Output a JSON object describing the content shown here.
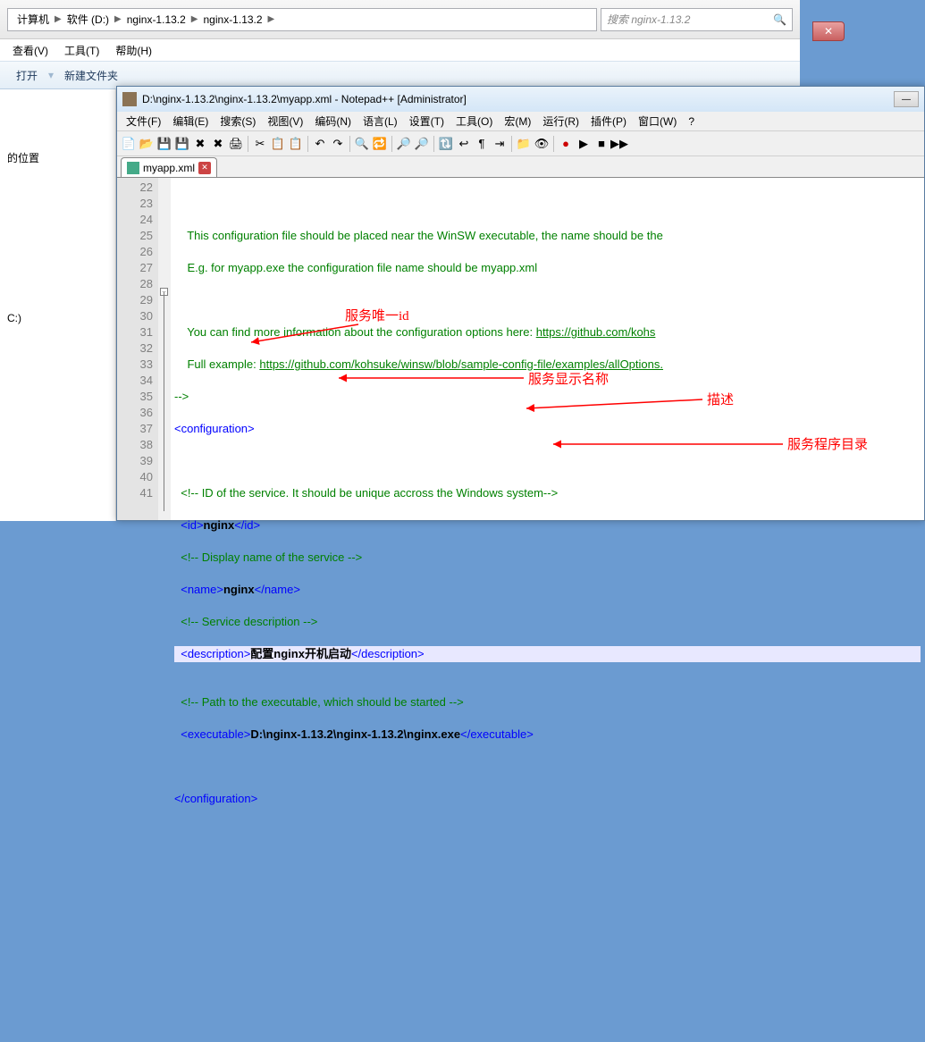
{
  "explorer": {
    "breadcrumb": [
      "计算机",
      "软件 (D:)",
      "nginx-1.13.2",
      "nginx-1.13.2"
    ],
    "search_placeholder": "搜索 nginx-1.13.2",
    "menu": [
      "查看(V)",
      "工具(T)",
      "帮助(H)"
    ],
    "toolbar": [
      "打开",
      "新建文件夹"
    ],
    "sidebar": {
      "item1": "的位置",
      "item2": "C:)"
    }
  },
  "npp": {
    "title": "D:\\nginx-1.13.2\\nginx-1.13.2\\myapp.xml - Notepad++ [Administrator]",
    "menu": [
      "文件(F)",
      "编辑(E)",
      "搜索(S)",
      "视图(V)",
      "编码(N)",
      "语言(L)",
      "设置(T)",
      "工具(O)",
      "宏(M)",
      "运行(R)",
      "插件(P)",
      "窗口(W)",
      "?"
    ],
    "tab": "myapp.xml",
    "lines": {
      "22": "",
      "23": "    This configuration file should be placed near the WinSW executable, the name should be the",
      "24": "    E.g. for myapp.exe the configuration file name should be myapp.xml",
      "25": "",
      "26_a": "    You can find more information about the configuration options here: ",
      "26_b": "https://github.com/kohs",
      "27_a": "    Full example: ",
      "27_b": "https://github.com/kohsuke/winsw/blob/sample-config-file/examples/allOptions.",
      "28": "-->",
      "29": "<configuration>",
      "30": "",
      "31": "  <!-- ID of the service. It should be unique accross the Windows system-->",
      "32_a": "<id>",
      "32_b": "nginx",
      "32_c": "</id>",
      "33": "  <!-- Display name of the service -->",
      "34_a": "<name>",
      "34_b": "nginx",
      "34_c": "</name>",
      "35": "  <!-- Service description -->",
      "36_a": "<description>",
      "36_b": "配置nginx开机启动",
      "36_c": "</description>",
      "37": "",
      "38": "  <!-- Path to the executable, which should be started -->",
      "39_a": "<executable>",
      "39_b": "D:\\nginx-1.13.2\\nginx-1.13.2\\nginx.exe",
      "39_c": "</executable>",
      "40": "",
      "41": "</configuration>"
    }
  },
  "annotations": {
    "a1": "服务唯一id",
    "a2": "服务显示名称",
    "a3": "描述",
    "a4": "服务程序目录"
  }
}
